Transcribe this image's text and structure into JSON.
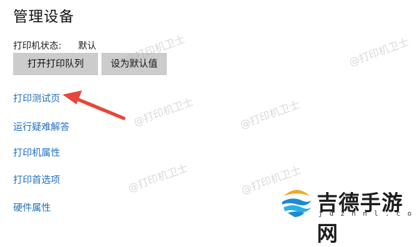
{
  "header": {
    "title": "管理设备"
  },
  "status": {
    "label": "打印机状态:",
    "value": "默认"
  },
  "buttons": {
    "open_queue": "打开打印队列",
    "set_default": "设为默认值"
  },
  "links": [
    {
      "label": "打印测试页"
    },
    {
      "label": "运行疑难解答"
    },
    {
      "label": "打印机属性"
    },
    {
      "label": "打印首选项"
    },
    {
      "label": "硬件属性"
    }
  ],
  "watermark": {
    "text": "@打印机卫士"
  },
  "logo": {
    "name": "吉德手游网",
    "domain": "jdzhnl.com"
  },
  "colors": {
    "link": "#1f6fbf",
    "button_bg": "#cccccc",
    "arrow": "#e8453c"
  }
}
